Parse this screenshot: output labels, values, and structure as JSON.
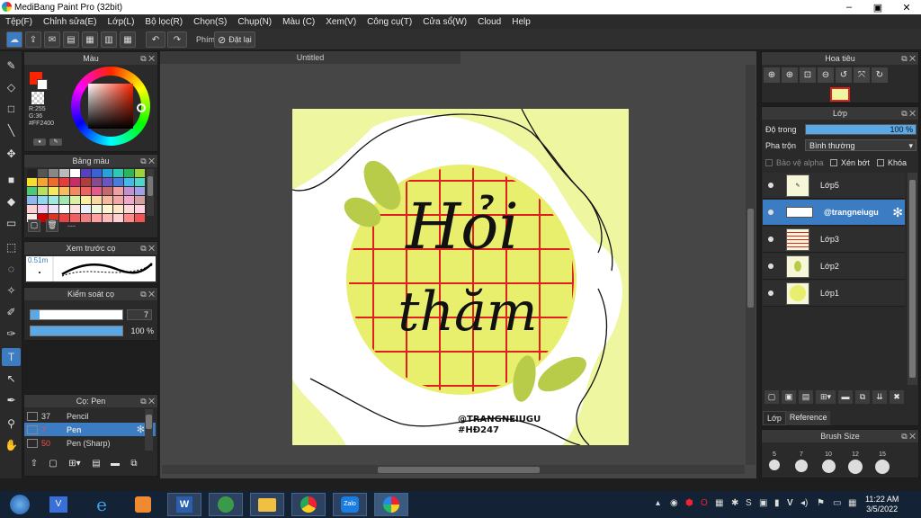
{
  "window": {
    "title": "MediBang Paint Pro (32bit)",
    "controls": [
      "–",
      "▣",
      "✕"
    ]
  },
  "menu": [
    "Tệp(F)",
    "Chỉnh sửa(E)",
    "Lớp(L)",
    "Bộ lọc(R)",
    "Chọn(S)",
    "Chụp(N)",
    "Màu (C)",
    "Xem(V)",
    "Công cụ(T)",
    "Cửa sổ(W)",
    "Cloud",
    "Help"
  ],
  "toolbar": {
    "hotkey_label": "Phím",
    "reset_label": "Đặt lại"
  },
  "color_panel": {
    "title": "Màu",
    "r": "R:255",
    "g": "G:36",
    "hex": "#FF2400",
    "primary_color": "#ff2400"
  },
  "palette_panel": {
    "title": "Bảng màu",
    "swatches": [
      "#222222",
      "#555555",
      "#888888",
      "#bbbbbb",
      "#ffffff",
      "#5a3fc0",
      "#3a62d8",
      "#2aa0d8",
      "#2fc7b6",
      "#2bb45a",
      "#9fd13a",
      "#f5df2c",
      "#f5a42c",
      "#f06a2c",
      "#e63c3c",
      "#cc2b6b",
      "#b23b3b",
      "#8a4a8a",
      "#6b54c6",
      "#4b7bdc",
      "#44b8e8",
      "#4fd6c8",
      "#4cc878",
      "#b8e060",
      "#f8e860",
      "#f8bc60",
      "#f48860",
      "#ee6262",
      "#e45a8e",
      "#c46a6a",
      "#f0a0a0",
      "#c090d0",
      "#a0a0e8",
      "#90b8f0",
      "#90d8f0",
      "#a0e8e0",
      "#a0e8b0",
      "#d8f0a0",
      "#f8f0a0",
      "#f8d8a0",
      "#f8b8a0",
      "#f0a8a8",
      "#f0a8c8",
      "#d0a0a0",
      "#ffd0d0",
      "#f8c8f0",
      "#f0e0f8",
      "#ffffff",
      "#ffe0e0",
      "#e8f0ff",
      "#f0f8e0",
      "#fff8d0",
      "#ffe8c8",
      "#ffd8d8",
      "#ffd0e0",
      "#ffe8e8",
      "#cc0000",
      "#dd3322",
      "#e84444",
      "#f06060",
      "#f08080",
      "#ffa0a0",
      "#ffb8b8",
      "#ffd0d0",
      "#ff8888",
      "#ee5555"
    ],
    "empty_label": "---"
  },
  "preview_panel": {
    "title": "Xem trước cọ",
    "size_label": "0.51m"
  },
  "control_panel": {
    "title": "Kiểm soát cọ",
    "size_value": "7",
    "opacity_value": "100 %",
    "size_fill": 0.1,
    "opacity_fill": 1.0
  },
  "brush_panel": {
    "title": "Cọ: Pen",
    "brushes": [
      {
        "size": "37",
        "name": "Pencil"
      },
      {
        "size": "7",
        "name": "Pen"
      },
      {
        "size": "50",
        "name": "Pen (Sharp)"
      }
    ]
  },
  "document": {
    "tab": "Untitled",
    "art_title_line1": "Hỏi",
    "art_title_line2": "thăm",
    "art_handle": "@TRANGNEIUGU",
    "art_tag": "#HĐ247"
  },
  "navigator_panel": {
    "title": "Hoa tiêu"
  },
  "layer_panel": {
    "title": "Lớp",
    "opacity_label": "Độ trong",
    "opacity_value": "100 %",
    "blend_label": "Pha trộn",
    "blend_value": "Bình thường",
    "protect_alpha": "Bảo vệ alpha",
    "clipping": "Xén bớt",
    "lock": "Khóa",
    "layers": [
      {
        "name": "Lớp5"
      },
      {
        "name": "@trangneiugu"
      },
      {
        "name": "Lớp3"
      },
      {
        "name": "Lớp2"
      },
      {
        "name": "Lớp1"
      }
    ],
    "tabs": [
      "Lớp",
      "Reference"
    ]
  },
  "brush_size_panel": {
    "title": "Brush Size",
    "sizes": [
      "5",
      "7",
      "10",
      "12",
      "15"
    ]
  },
  "taskbar": {
    "lang": "V",
    "time": "11:22 AM",
    "date": "3/5/2022"
  }
}
